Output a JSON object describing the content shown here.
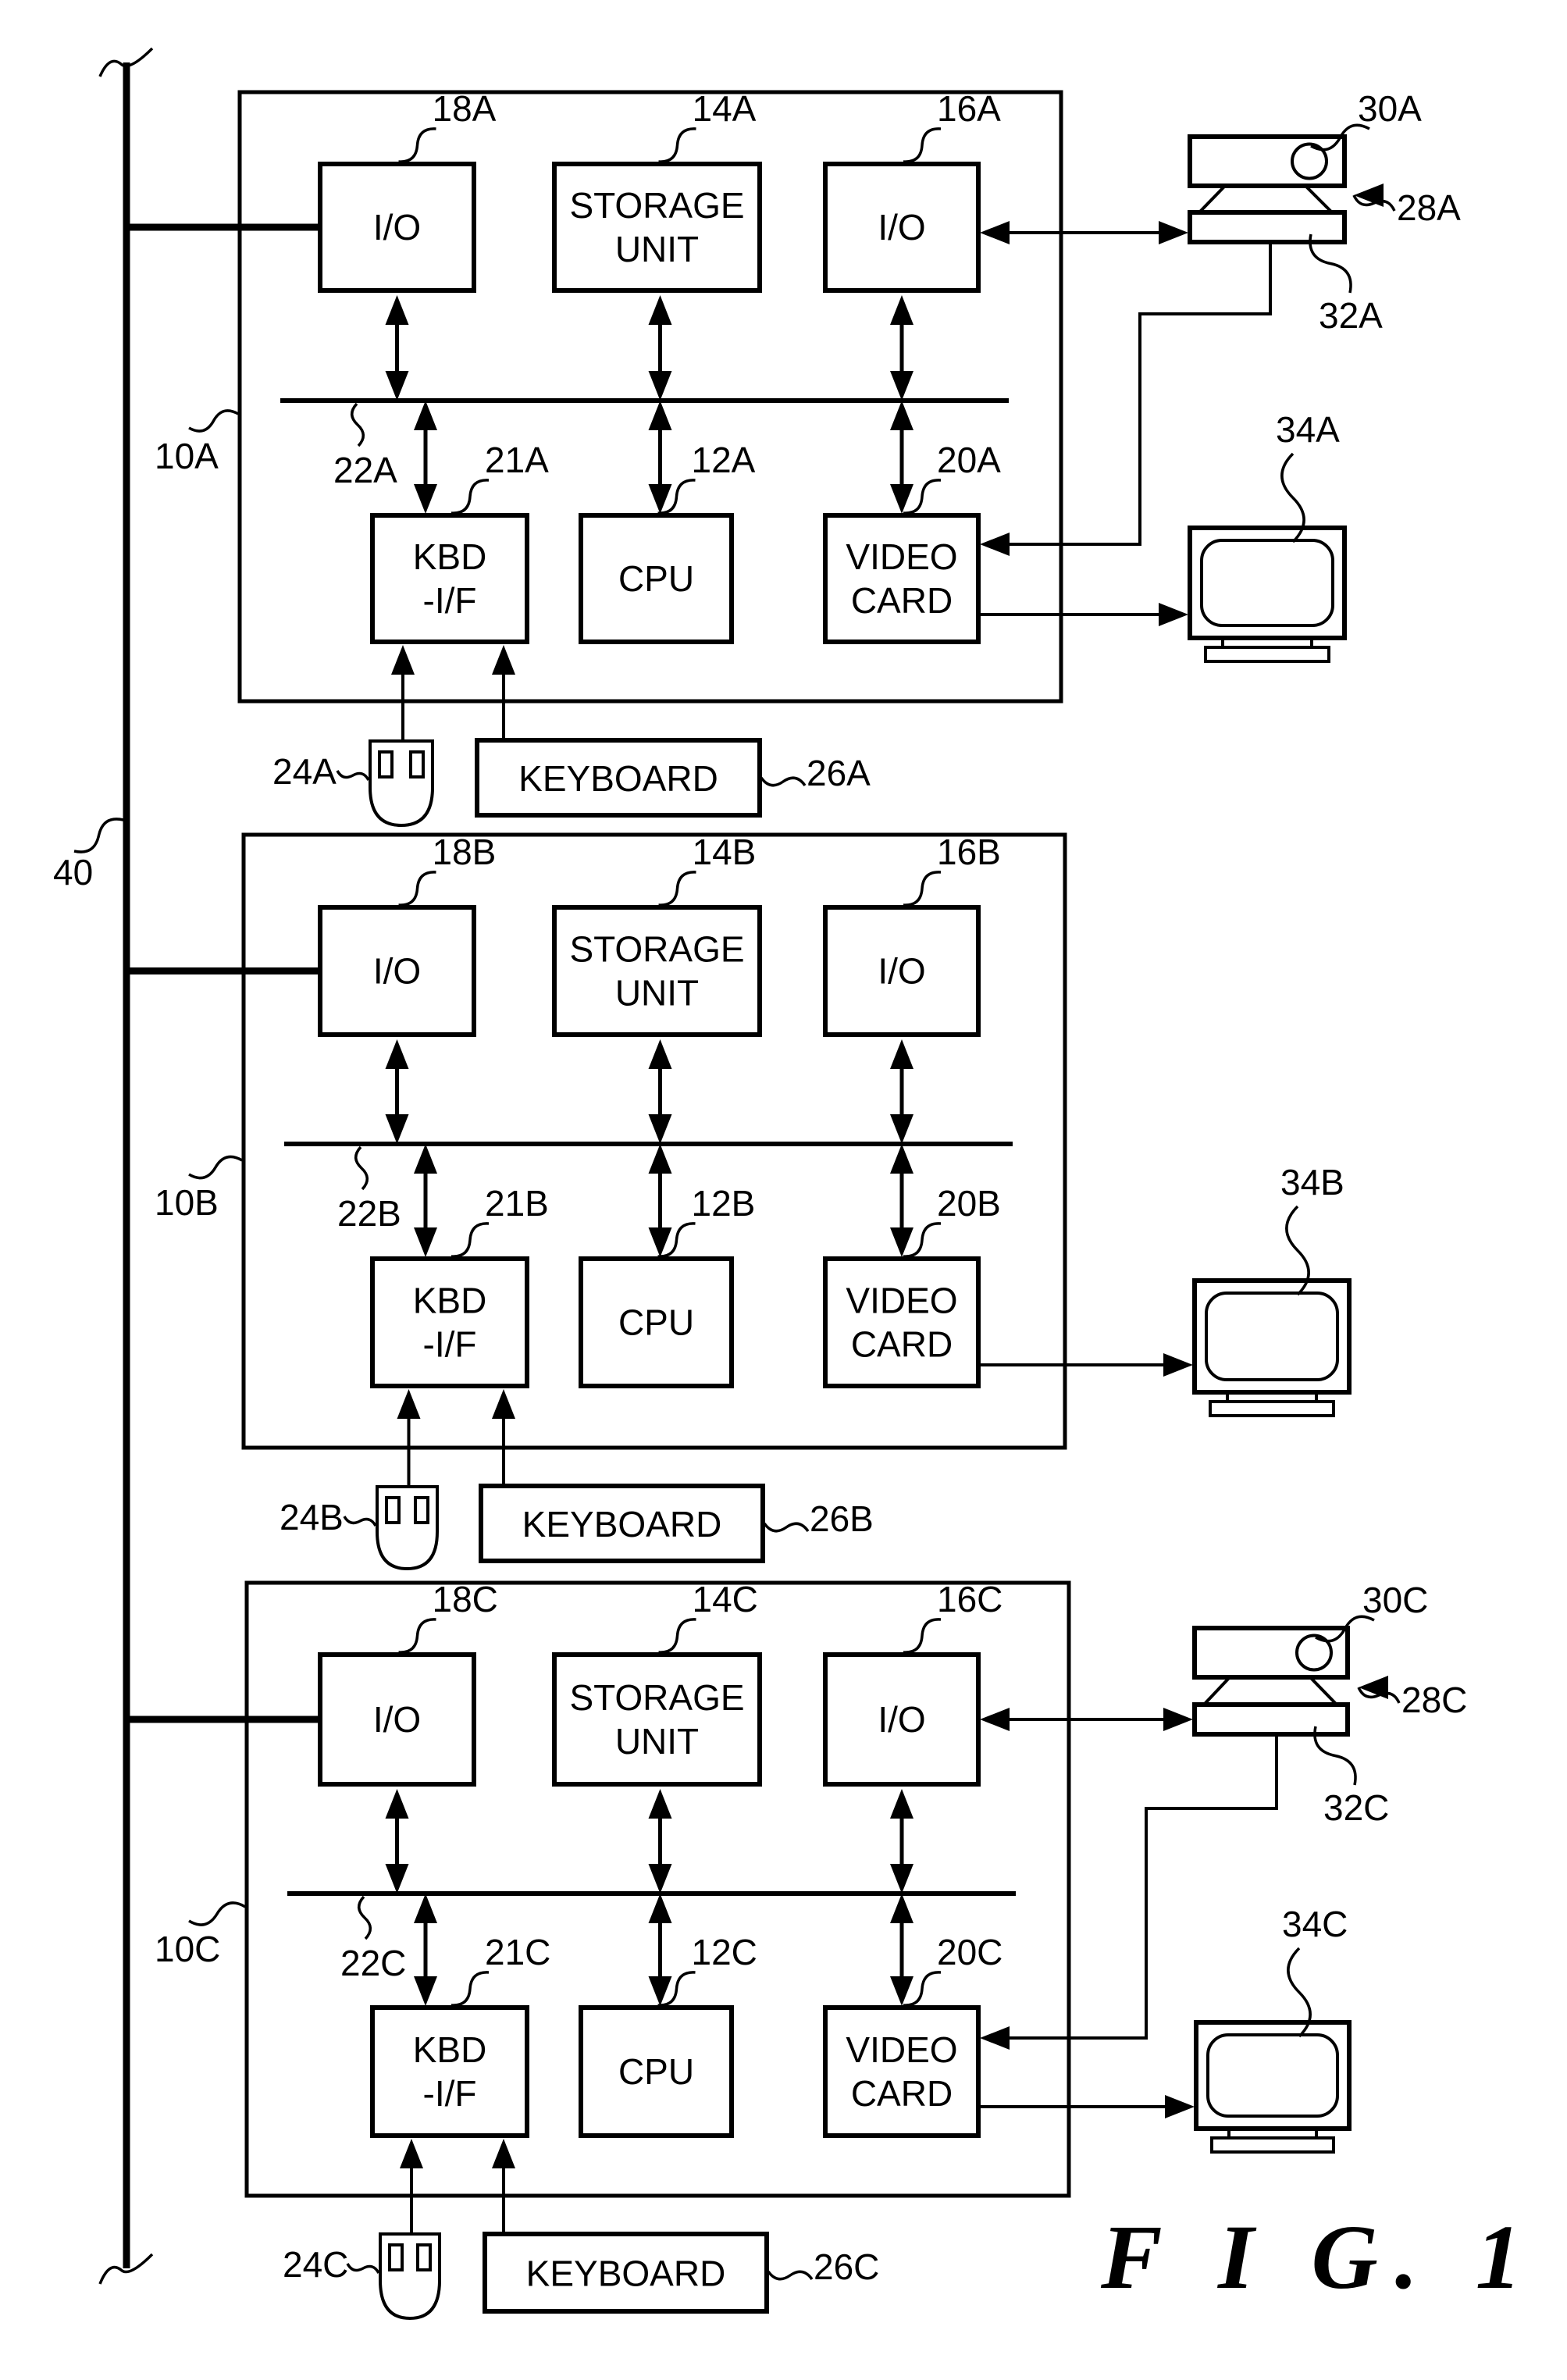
{
  "figure": {
    "title": "F I G.  1",
    "network_bus_label": "40"
  },
  "units": [
    {
      "id": "A",
      "computer_label": "10A",
      "internal_bus_label": "22A",
      "has_camera": true,
      "components": {
        "io_network": {
          "ref": "18A",
          "text": [
            "I/O"
          ]
        },
        "storage": {
          "ref": "14A",
          "text": [
            "STORAGE",
            "UNIT"
          ]
        },
        "io_camera": {
          "ref": "16A",
          "text": [
            "I/O"
          ]
        },
        "kbd_if": {
          "ref": "21A",
          "text": [
            "KBD",
            "-I/F"
          ]
        },
        "cpu": {
          "ref": "12A",
          "text": [
            "CPU"
          ]
        },
        "video_card": {
          "ref": "20A",
          "text": [
            "VIDEO",
            "CARD"
          ]
        }
      },
      "peripherals": {
        "mouse": {
          "ref": "24A"
        },
        "keyboard": {
          "ref": "26A",
          "text": "KEYBOARD"
        },
        "camera_unit": {
          "ref": "28A"
        },
        "camera_lens": {
          "ref": "30A"
        },
        "camera_base": {
          "ref": "32A"
        },
        "monitor": {
          "ref": "34A"
        }
      }
    },
    {
      "id": "B",
      "computer_label": "10B",
      "internal_bus_label": "22B",
      "has_camera": false,
      "components": {
        "io_network": {
          "ref": "18B",
          "text": [
            "I/O"
          ]
        },
        "storage": {
          "ref": "14B",
          "text": [
            "STORAGE",
            "UNIT"
          ]
        },
        "io_camera": {
          "ref": "16B",
          "text": [
            "I/O"
          ]
        },
        "kbd_if": {
          "ref": "21B",
          "text": [
            "KBD",
            "-I/F"
          ]
        },
        "cpu": {
          "ref": "12B",
          "text": [
            "CPU"
          ]
        },
        "video_card": {
          "ref": "20B",
          "text": [
            "VIDEO",
            "CARD"
          ]
        }
      },
      "peripherals": {
        "mouse": {
          "ref": "24B"
        },
        "keyboard": {
          "ref": "26B",
          "text": "KEYBOARD"
        },
        "monitor": {
          "ref": "34B"
        }
      }
    },
    {
      "id": "C",
      "computer_label": "10C",
      "internal_bus_label": "22C",
      "has_camera": true,
      "components": {
        "io_network": {
          "ref": "18C",
          "text": [
            "I/O"
          ]
        },
        "storage": {
          "ref": "14C",
          "text": [
            "STORAGE",
            "UNIT"
          ]
        },
        "io_camera": {
          "ref": "16C",
          "text": [
            "I/O"
          ]
        },
        "kbd_if": {
          "ref": "21C",
          "text": [
            "KBD",
            "-I/F"
          ]
        },
        "cpu": {
          "ref": "12C",
          "text": [
            "CPU"
          ]
        },
        "video_card": {
          "ref": "20C",
          "text": [
            "VIDEO",
            "CARD"
          ]
        }
      },
      "peripherals": {
        "mouse": {
          "ref": "24C"
        },
        "keyboard": {
          "ref": "26C",
          "text": "KEYBOARD"
        },
        "camera_unit": {
          "ref": "28C"
        },
        "camera_lens": {
          "ref": "30C"
        },
        "camera_base": {
          "ref": "32C"
        },
        "monitor": {
          "ref": "34C"
        }
      }
    }
  ]
}
